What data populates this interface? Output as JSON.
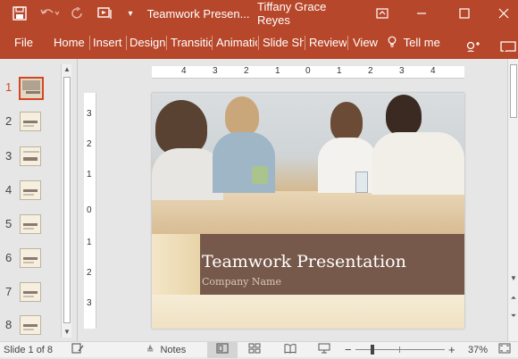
{
  "titlebar": {
    "document_title": "Teamwork Presen...",
    "user_name": "Tiffany Grace Reyes",
    "qat": {
      "save_icon": "save-icon",
      "undo_icon": "undo-icon",
      "redo_icon": "redo-icon",
      "present_icon": "present-from-start-icon",
      "customize_icon": "customize-qat-icon"
    },
    "window_controls": {
      "ribbon_display": "ribbon-display-options-icon",
      "minimize": "minimize-icon",
      "maximize": "maximize-icon",
      "close": "close-icon"
    }
  },
  "menu": {
    "items": [
      "File",
      "Home",
      "Insert",
      "Design",
      "Transitic",
      "Animatic",
      "Slide Sh",
      "Review",
      "View"
    ],
    "tell_me": "Tell me",
    "share_icon": "share-user-icon",
    "comments_icon": "comments-icon"
  },
  "thumbnails": {
    "numbers": [
      "1",
      "2",
      "3",
      "4",
      "5",
      "6",
      "7",
      "8"
    ],
    "active_index": 0
  },
  "ruler": {
    "horizontal": [
      "4",
      "3",
      "2",
      "1",
      "0",
      "1",
      "2",
      "3",
      "4"
    ],
    "vertical": [
      "3",
      "2",
      "1",
      "0",
      "1",
      "2",
      "3"
    ]
  },
  "slide": {
    "title": "Teamwork Presentation",
    "subtitle": "Company Name"
  },
  "status": {
    "slide_info": "Slide 1 of 8",
    "notes_label": "Notes",
    "zoom_minus": "−",
    "zoom_plus": "+",
    "zoom_level": "37%",
    "zoom_fraction": 0.37
  },
  "colors": {
    "accent": "#b7472a",
    "title_band": "#77594b",
    "slide_bg": "#f7f0e0"
  }
}
